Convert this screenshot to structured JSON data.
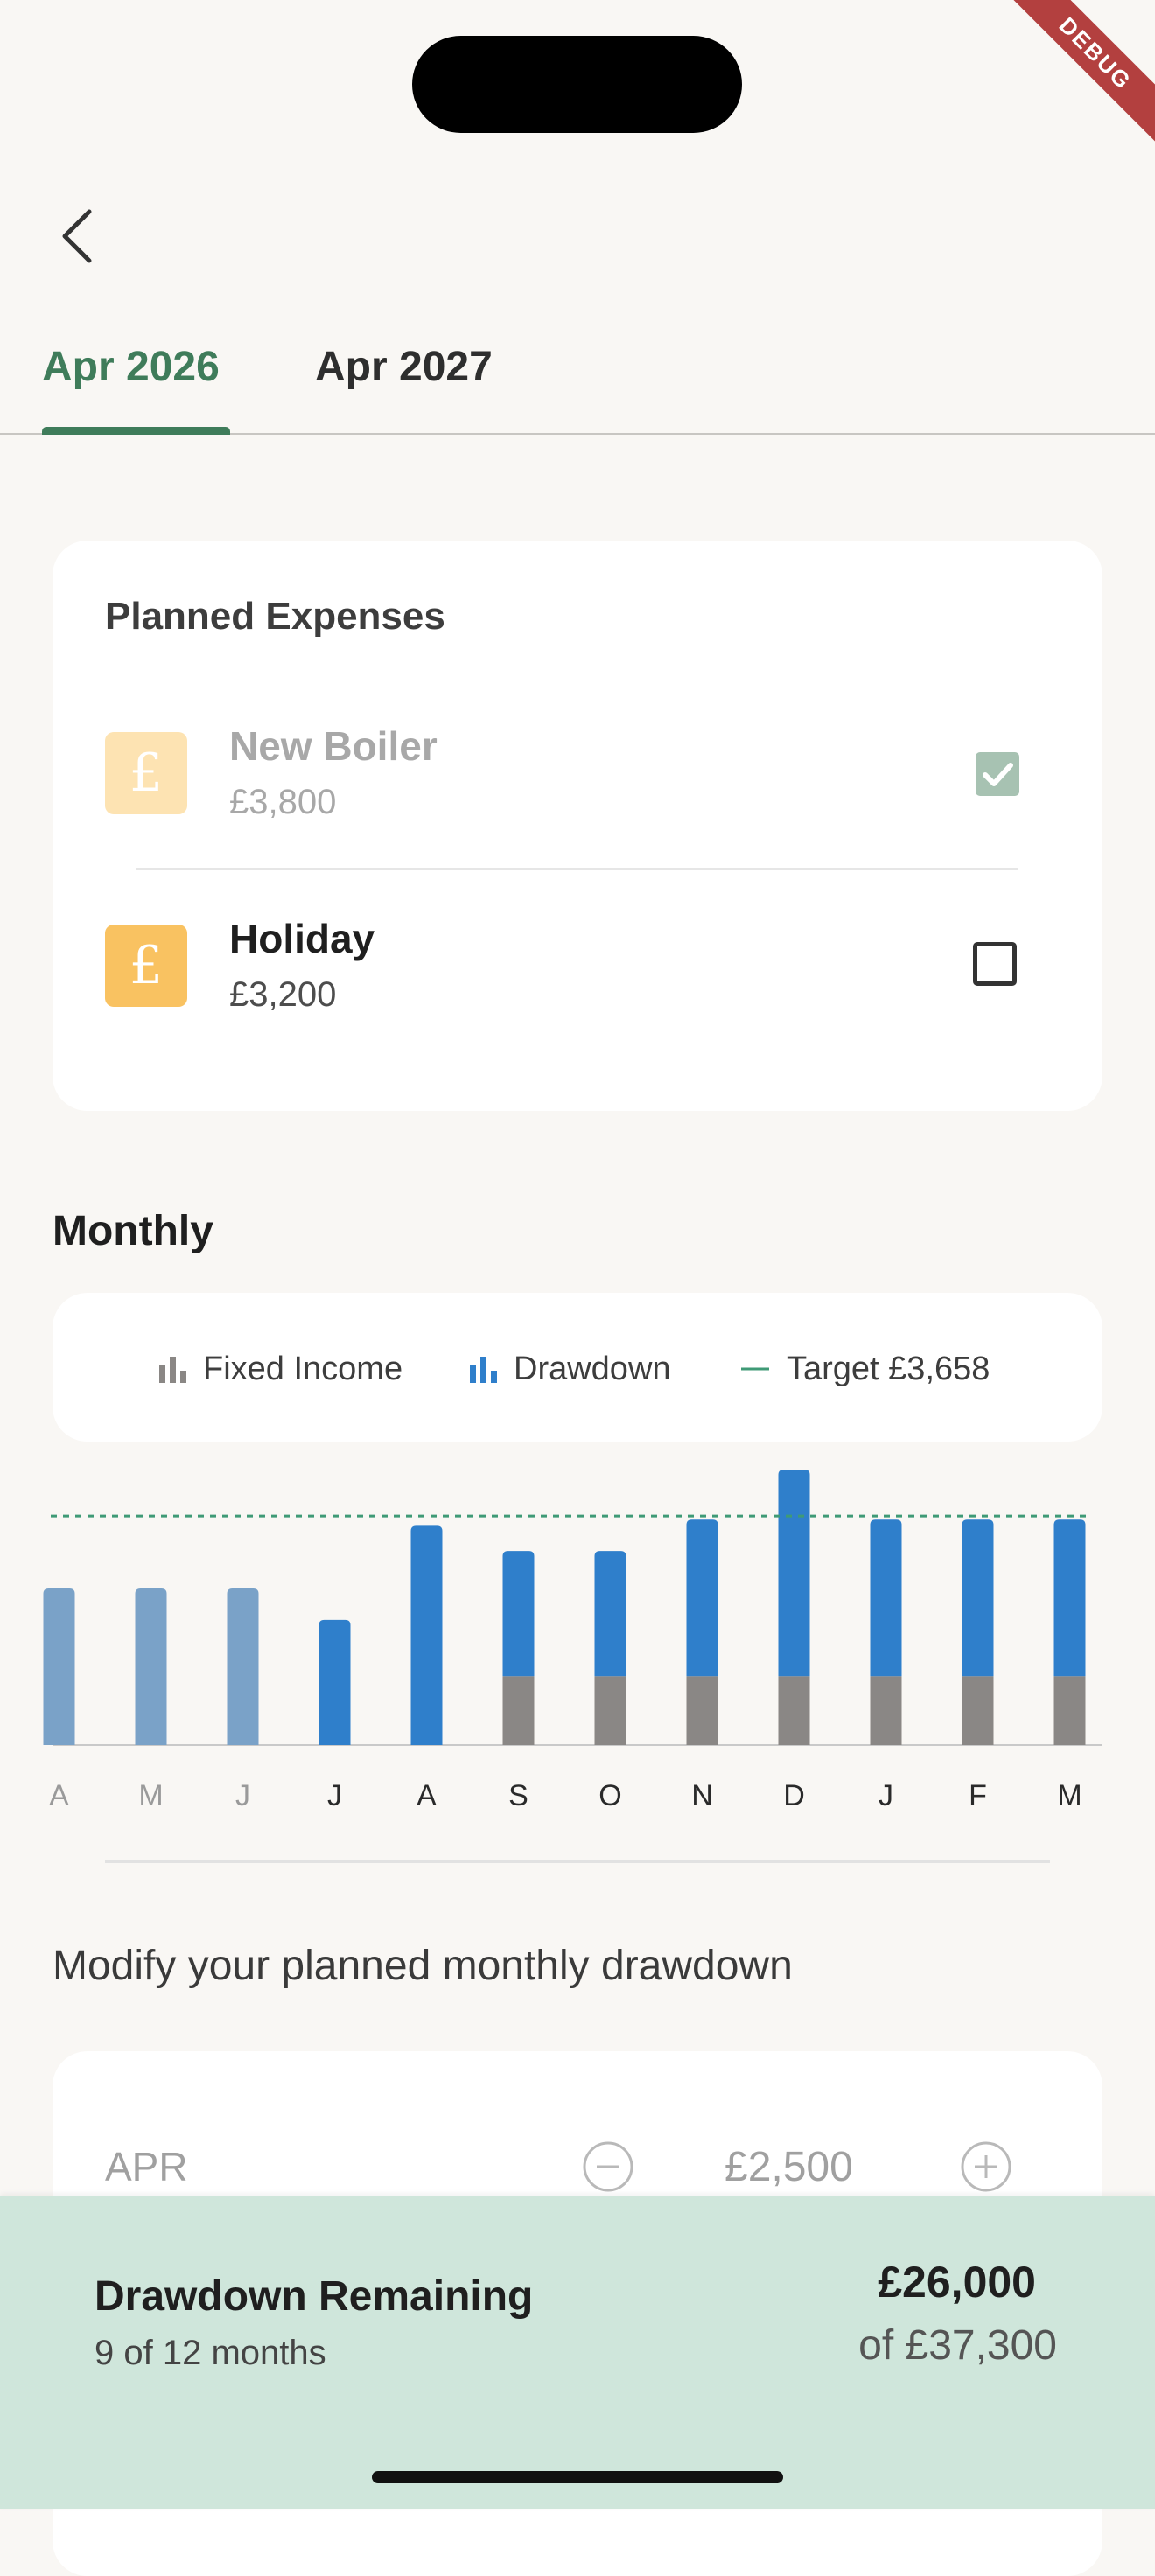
{
  "debug_banner": "DEBUG",
  "tabs": [
    {
      "label": "Apr 2026",
      "active": true
    },
    {
      "label": "Apr 2027",
      "active": false
    }
  ],
  "planned_expenses": {
    "title": "Planned Expenses",
    "items": [
      {
        "icon": "pound-icon",
        "symbol": "£",
        "name": "New Boiler",
        "amount": "£3,800",
        "checked": true
      },
      {
        "icon": "pound-icon",
        "symbol": "£",
        "name": "Holiday",
        "amount": "£3,200",
        "checked": false
      }
    ]
  },
  "monthly": {
    "title": "Monthly",
    "legend": [
      {
        "label": "Fixed Income",
        "icon": "bar-chart-icon",
        "color": "#8a8785"
      },
      {
        "label": "Drawdown",
        "icon": "bar-chart-icon",
        "color": "#2f7fcb"
      },
      {
        "label": "Target £3,658",
        "icon": "line-icon",
        "color": "#3f9a76"
      }
    ]
  },
  "chart_data": {
    "type": "bar",
    "stacked": true,
    "categories": [
      "A",
      "M",
      "J",
      "J",
      "A",
      "S",
      "O",
      "N",
      "D",
      "J",
      "F",
      "M"
    ],
    "past_months_count": 3,
    "series": [
      {
        "name": "Fixed Income",
        "color": "#8a8785",
        "values": [
          0,
          0,
          0,
          0,
          0,
          1100,
          1100,
          1100,
          1100,
          1100,
          1100,
          1100
        ]
      },
      {
        "name": "Drawdown",
        "color": "#2f7fcb",
        "values": [
          2500,
          2500,
          2500,
          2000,
          3500,
          2000,
          2000,
          2500,
          3300,
          2500,
          2500,
          2500
        ]
      }
    ],
    "target": 3658,
    "target_label": "Target £3,658",
    "past_color": "#7aa2c8",
    "ylim": [
      0,
      4400
    ]
  },
  "modify": {
    "heading": "Modify your planned monthly drawdown",
    "rows": [
      {
        "month": "APR",
        "value": "£2,500"
      }
    ]
  },
  "summary": {
    "title": "Drawdown Remaining",
    "subtitle": "9 of 12 months",
    "amount": "£26,000",
    "of_total": "of £37,300"
  }
}
